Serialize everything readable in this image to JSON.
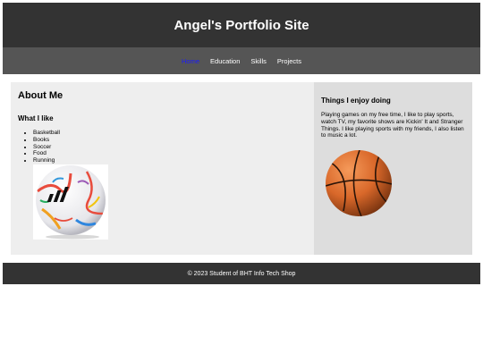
{
  "header": {
    "title": "Angel's Portfolio Site"
  },
  "nav": {
    "items": [
      {
        "label": "Home",
        "active": true
      },
      {
        "label": "Education"
      },
      {
        "label": "Skills"
      },
      {
        "label": "Projects"
      }
    ]
  },
  "main": {
    "heading": "About Me",
    "subheading": "What I like",
    "likes": [
      "Basketball",
      "Books",
      "Soccer",
      "Food",
      "Running"
    ]
  },
  "aside": {
    "heading": "Things I enjoy doing",
    "paragraph": "Playing games on my free time, I like to play sports, watch TV, my favorite shows are Kickin' It and Stranger Things. I like playing sports with my friends, I also listen to music a lot."
  },
  "footer": {
    "text": "© 2023 Student of BHT Info Tech Shop"
  },
  "colors": {
    "header_bg": "#333333",
    "nav_bg": "#555555",
    "active_link": "#1a1aff",
    "main_bg": "#eeeeee",
    "aside_bg": "#dddddd"
  }
}
